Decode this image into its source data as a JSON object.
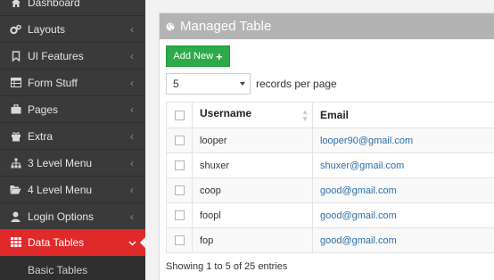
{
  "sidebar": {
    "items": [
      {
        "label": "Dashboard",
        "icon": "home-icon"
      },
      {
        "label": "Layouts",
        "icon": "cogs-icon"
      },
      {
        "label": "UI Features",
        "icon": "bookmark-icon"
      },
      {
        "label": "Form Stuff",
        "icon": "table-icon"
      },
      {
        "label": "Pages",
        "icon": "briefcase-icon"
      },
      {
        "label": "Extra",
        "icon": "gift-icon"
      },
      {
        "label": "3 Level Menu",
        "icon": "sitemap-icon"
      },
      {
        "label": "4 Level Menu",
        "icon": "folder-open-icon"
      },
      {
        "label": "Login Options",
        "icon": "user-icon"
      },
      {
        "label": "Data Tables",
        "icon": "grid-icon"
      }
    ],
    "active": "Data Tables",
    "sub_items": [
      "Basic Tables"
    ],
    "colors": {
      "background": "#3a3a3a",
      "active": "#e02a2a"
    }
  },
  "panel": {
    "title": "Managed Table",
    "add_button": "Add New",
    "per_page_value": "5",
    "per_page_label": "records per page",
    "columns": [
      "Username",
      "Email"
    ],
    "rows": [
      {
        "username": "looper",
        "email": "looper90@gmail.com"
      },
      {
        "username": "shuxer",
        "email": "shuxer@gmail.com"
      },
      {
        "username": "coop",
        "email": "good@gmail.com"
      },
      {
        "username": "foopl",
        "email": "good@gmail.com"
      },
      {
        "username": "fop",
        "email": "good@gmail.com"
      }
    ],
    "info": "Showing 1 to 5 of 25 entries",
    "colors": {
      "header": "#b3b3b3",
      "button": "#2daa4a",
      "link": "#2a6ea8"
    }
  }
}
